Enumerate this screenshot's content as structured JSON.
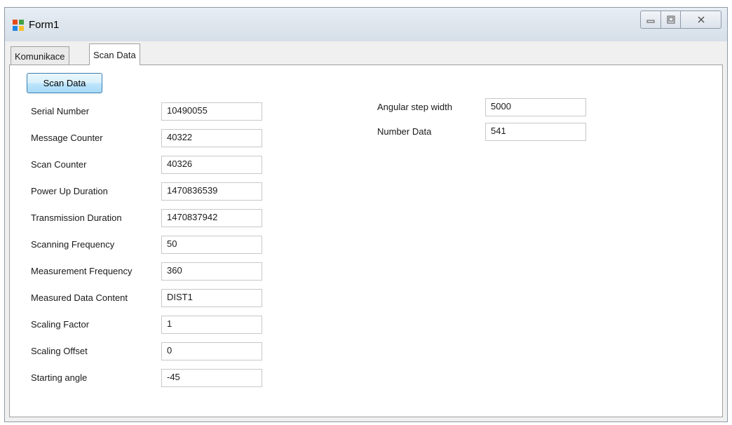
{
  "window": {
    "title": "Form1",
    "controls": [
      "minimize",
      "maximize",
      "close"
    ]
  },
  "tabs": [
    {
      "label": "Komunikace",
      "active": false
    },
    {
      "label": "Scan Data",
      "active": true
    }
  ],
  "scan_button": "Scan Data",
  "left_fields": [
    {
      "label": "Serial Number",
      "value": "10490055"
    },
    {
      "label": "Message Counter",
      "value": "40322"
    },
    {
      "label": "Scan Counter",
      "value": "40326"
    },
    {
      "label": "Power Up Duration",
      "value": "1470836539"
    },
    {
      "label": "Transmission Duration",
      "value": "1470837942"
    },
    {
      "label": "Scanning Frequency",
      "value": "50"
    },
    {
      "label": "Measurement Frequency",
      "value": "360"
    },
    {
      "label": "Measured Data Content",
      "value": "DIST1"
    },
    {
      "label": "Scaling Factor",
      "value": "1"
    },
    {
      "label": "Scaling Offset",
      "value": "0"
    },
    {
      "label": "Starting angle",
      "value": "-45"
    }
  ],
  "right_fields": [
    {
      "label": "Angular step width",
      "value": "5000"
    },
    {
      "label": "Number Data",
      "value": "541"
    }
  ]
}
